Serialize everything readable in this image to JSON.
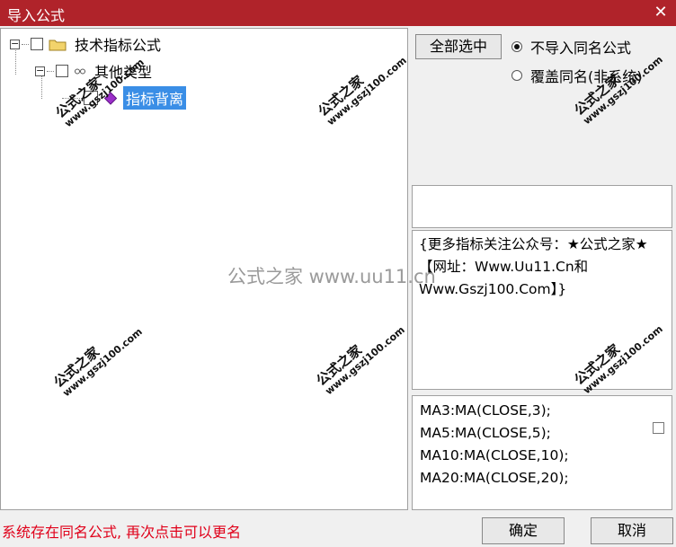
{
  "window": {
    "title": "导入公式",
    "close_glyph": "✕"
  },
  "tree": {
    "root": {
      "label": "技术指标公式",
      "expander": "⊟"
    },
    "category": {
      "label": "其他类型",
      "expander": "⊟"
    },
    "item": {
      "label": "指标背离"
    }
  },
  "options": {
    "select_all_label": "全部选中",
    "radio_no_import": "不导入同名公式",
    "radio_overwrite": "覆盖同名(非系统)",
    "selected_radio": "no_import"
  },
  "description": "{更多指标关注公众号：★公式之家★ 【网址：Www.Uu11.Cn和Www.Gszj100.Com】}",
  "code_lines": [
    "MA3:MA(CLOSE,3);",
    "MA5:MA(CLOSE,5);",
    "MA10:MA(CLOSE,10);",
    "MA20:MA(CLOSE,20);"
  ],
  "status_text": "系统存在同名公式, 再次点击可以更名",
  "buttons": {
    "ok": "确定",
    "cancel": "取消"
  },
  "watermark": {
    "cn": "公式之家",
    "url": "www.gszj100.com",
    "center": "公式之家 www.uu11.cn"
  },
  "colors": {
    "titlebar": "#b0232a",
    "selection": "#3a8ee6",
    "status": "#e0001a"
  }
}
